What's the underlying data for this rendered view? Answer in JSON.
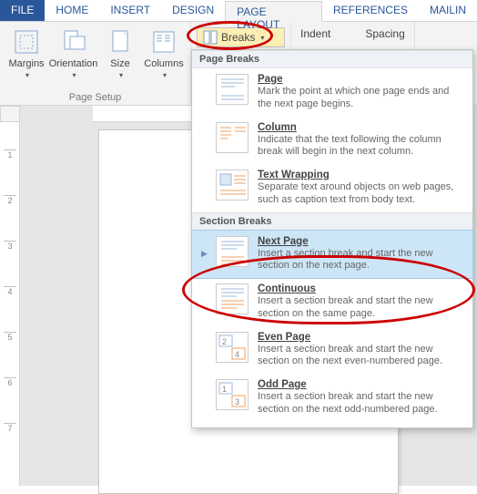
{
  "tabs": {
    "file": "FILE",
    "home": "HOME",
    "insert": "INSERT",
    "design": "DESIGN",
    "page_layout": "PAGE LAYOUT",
    "references": "REFERENCES",
    "mailings": "MAILIN"
  },
  "ribbon": {
    "page_setup": {
      "caption": "Page Setup",
      "margins": "Margins",
      "orientation": "Orientation",
      "size": "Size",
      "columns": "Columns",
      "breaks": "Breaks",
      "line_numbers": "",
      "hyphenation": ""
    },
    "paragraph": {
      "indent": "Indent",
      "spacing": "Spacing"
    }
  },
  "menu": {
    "section_page_breaks": "Page Breaks",
    "section_section_breaks": "Section Breaks",
    "items": {
      "page": {
        "title": "Page",
        "desc": "Mark the point at which one page ends and the next page begins."
      },
      "column": {
        "title": "Column",
        "desc": "Indicate that the text following the column break will begin in the next column."
      },
      "text_wrap": {
        "title": "Text Wrapping",
        "desc": "Separate text around objects on web pages, such as caption text from body text."
      },
      "next_page": {
        "title": "Next Page",
        "desc": "Insert a section break and start the new section on the next page."
      },
      "continuous": {
        "title": "Continuous",
        "desc": "Insert a section break and start the new section on the same page."
      },
      "even_page": {
        "title": "Even Page",
        "desc": "Insert a section break and start the new section on the next even-numbered page."
      },
      "odd_page": {
        "title": "Odd Page",
        "desc": "Insert a section break and start the new section on the next odd-numbered page."
      }
    }
  },
  "ruler": {
    "v1": "1",
    "v2": "2",
    "v3": "3",
    "v4": "4",
    "v5": "5",
    "v6": "6",
    "v7": "7"
  }
}
